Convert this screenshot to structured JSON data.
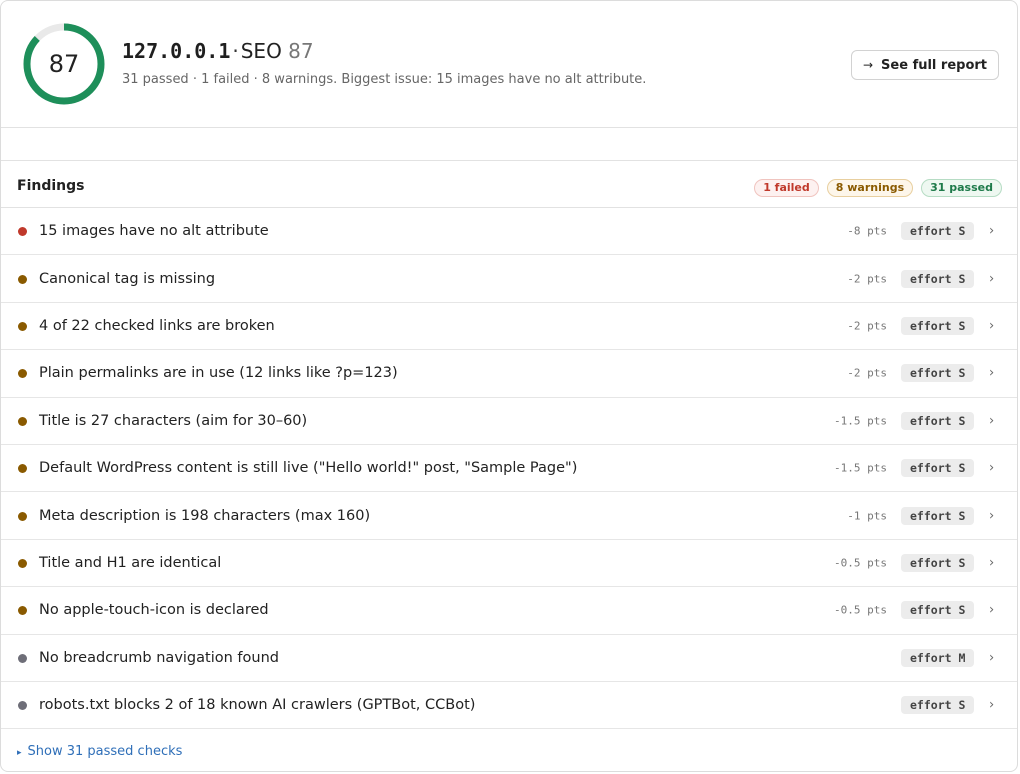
{
  "header": {
    "score": "87",
    "score_fraction": 0.87,
    "ring_color": "#1e8f5a",
    "host": "127.0.0.1",
    "separator": "·",
    "category": "SEO",
    "category_score": "87",
    "summary": "31 passed · 1 failed · 8 warnings. Biggest issue: 15 images have no alt attribute.",
    "report_arrow": "→",
    "report_label": "See full report"
  },
  "findings": {
    "title": "Findings",
    "pills": {
      "failed": "1 failed",
      "warnings": "8 warnings",
      "passed": "31 passed"
    },
    "colors": {
      "failed": "#c0392b",
      "warning": "#8a5a00",
      "info": "#6e6e78"
    },
    "rows": [
      {
        "label": "15 images have no alt attribute",
        "pts": "-8 pts",
        "effort": "effort S",
        "severity": "failed"
      },
      {
        "label": "Canonical tag is missing",
        "pts": "-2 pts",
        "effort": "effort S",
        "severity": "warning"
      },
      {
        "label": "4 of 22 checked links are broken",
        "pts": "-2 pts",
        "effort": "effort S",
        "severity": "warning"
      },
      {
        "label": "Plain permalinks are in use (12 links like ?p=123)",
        "pts": "-2 pts",
        "effort": "effort S",
        "severity": "warning"
      },
      {
        "label": "Title is 27 characters (aim for 30–60)",
        "pts": "-1.5 pts",
        "effort": "effort S",
        "severity": "warning"
      },
      {
        "label": "Default WordPress content is still live (\"Hello world!\" post, \"Sample Page\")",
        "pts": "-1.5 pts",
        "effort": "effort S",
        "severity": "warning"
      },
      {
        "label": "Meta description is 198 characters (max 160)",
        "pts": "-1 pts",
        "effort": "effort S",
        "severity": "warning"
      },
      {
        "label": "Title and H1 are identical",
        "pts": "-0.5 pts",
        "effort": "effort S",
        "severity": "warning"
      },
      {
        "label": "No apple-touch-icon is declared",
        "pts": "-0.5 pts",
        "effort": "effort S",
        "severity": "warning"
      },
      {
        "label": "No breadcrumb navigation found",
        "pts": "",
        "effort": "effort M",
        "severity": "info"
      },
      {
        "label": "robots.txt blocks 2 of 18 known AI crawlers (GPTBot, CCBot)",
        "pts": "",
        "effort": "effort S",
        "severity": "info"
      }
    ],
    "row_chevron": "›"
  },
  "footer": {
    "toggle_icon": "▸",
    "label": "Show 31 passed checks"
  }
}
